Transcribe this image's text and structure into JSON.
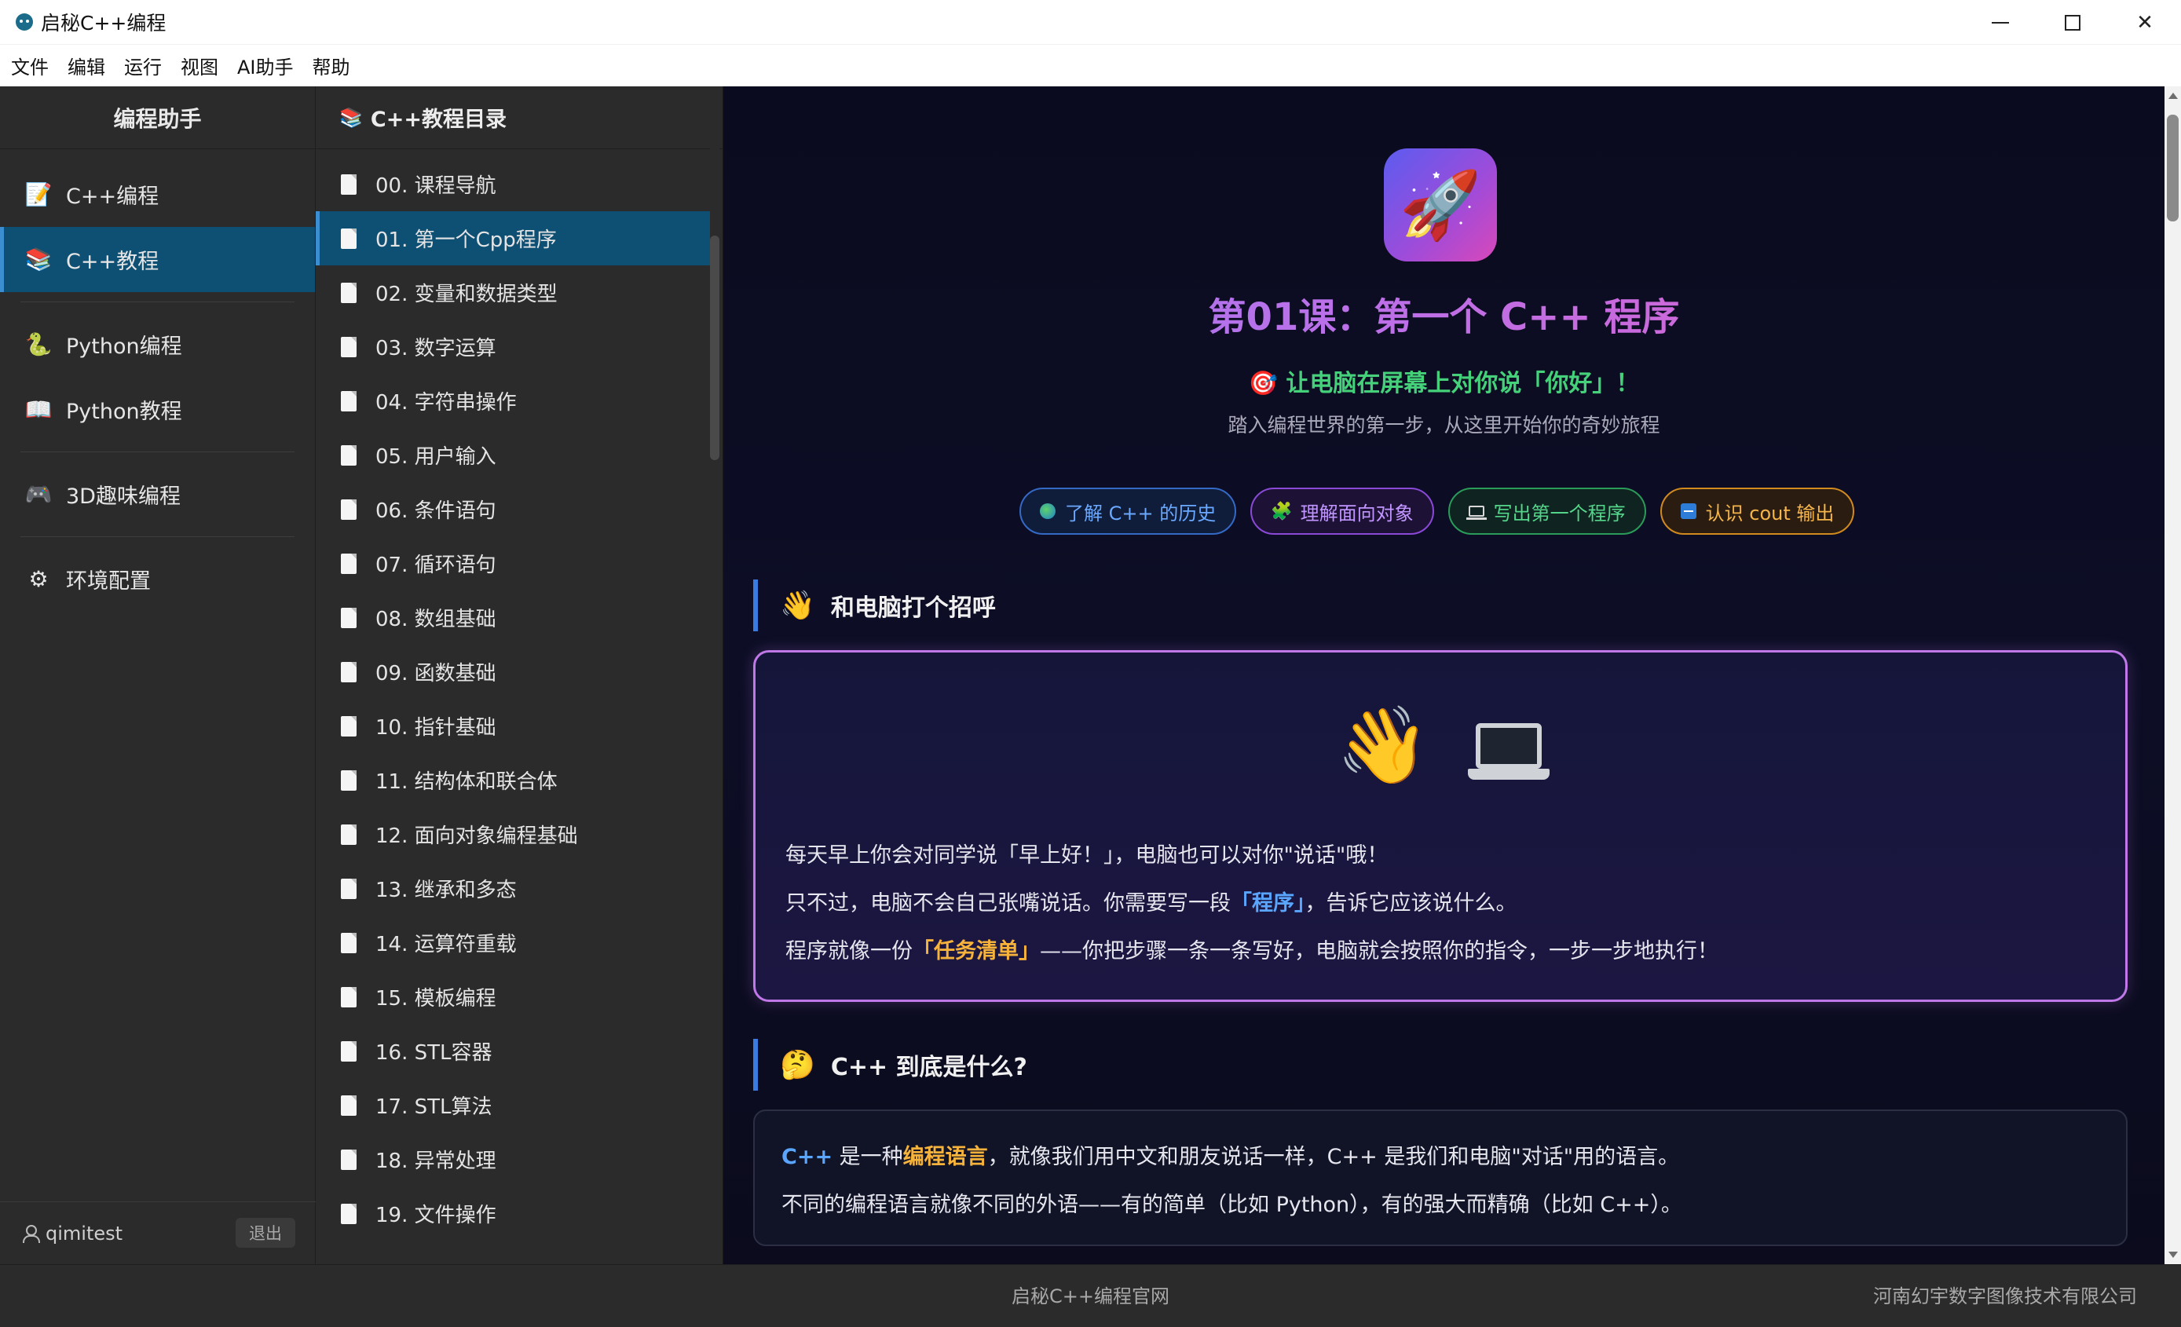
{
  "window": {
    "title": "启秘C++编程"
  },
  "menubar": {
    "items": [
      "文件",
      "编辑",
      "运行",
      "视图",
      "AI助手",
      "帮助"
    ]
  },
  "sidebar": {
    "title": "编程助手",
    "items": [
      {
        "label": "C++编程",
        "icon": "memo-icon"
      },
      {
        "label": "C++教程",
        "icon": "books-icon"
      },
      {
        "label": "Python编程",
        "icon": "snake-icon"
      },
      {
        "label": "Python教程",
        "icon": "open-book-icon"
      },
      {
        "label": "3D趣味编程",
        "icon": "gamepad-icon"
      },
      {
        "label": "环境配置",
        "icon": "gear-icon"
      }
    ],
    "active_index": 1,
    "user": "qimitest",
    "logout_label": "退出"
  },
  "toc": {
    "title": "C++教程目录",
    "items": [
      "00. 课程导航",
      "01. 第一个Cpp程序",
      "02. 变量和数据类型",
      "03. 数字运算",
      "04. 字符串操作",
      "05. 用户输入",
      "06. 条件语句",
      "07. 循环语句",
      "08. 数组基础",
      "09. 函数基础",
      "10. 指针基础",
      "11. 结构体和联合体",
      "12. 面向对象编程基础",
      "13. 继承和多态",
      "14. 运算符重载",
      "15. 模板编程",
      "16. STL容器",
      "17. STL算法",
      "18. 异常处理",
      "19. 文件操作"
    ],
    "active_index": 1
  },
  "lesson": {
    "title": "第01课：第一个 C++ 程序",
    "tagline": "🎯 让电脑在屏幕上对你说「你好」！",
    "desc": "踏入编程世界的第一步，从这里开始你的奇妙旅程",
    "tags": [
      {
        "label": "了解 C++ 的历史",
        "color": "#6aa9ff"
      },
      {
        "label": "理解面向对象",
        "color": "#c195ff"
      },
      {
        "label": "写出第一个程序",
        "color": "#54d68a"
      },
      {
        "label": "认识 cout 输出",
        "color": "#f5b54a"
      }
    ],
    "section1": {
      "title": "和电脑打个招呼",
      "line1": "每天早上你会对同学说「早上好！」，电脑也可以对你\"说话\"哦！",
      "line2_a": "只不过，电脑不会自己张嘴说话。你需要写一段",
      "line2_hl": "「程序」",
      "line2_b": "，告诉它应该说什么。",
      "line3_a": "程序就像一份",
      "line3_hl": "「任务清单」",
      "line3_b": "——你把步骤一条一条写好，电脑就会按照你的指令，一步一步地执行！"
    },
    "section2": {
      "title": "C++ 到底是什么?",
      "line1_cpp": "C++",
      "line1_a": " 是一种",
      "line1_hl": "编程语言",
      "line1_b": "，就像我们用中文和朋友说话一样，C++ 是我们和电脑\"对话\"用的语言。",
      "line2": "不同的编程语言就像不同的外语——有的简单（比如 Python），有的强大而精确（比如 C++）。"
    }
  },
  "footer": {
    "center": "启秘C++编程官网",
    "right": "河南幻宇数字图像技术有限公司"
  },
  "colors": {
    "accent": "#0e4f74",
    "accent_border": "#3b8fd1",
    "tagline": "#45d17a",
    "highlight_blue": "#5aa6ff",
    "highlight_orange": "#f6b33c",
    "card_border": "#c078e8"
  }
}
